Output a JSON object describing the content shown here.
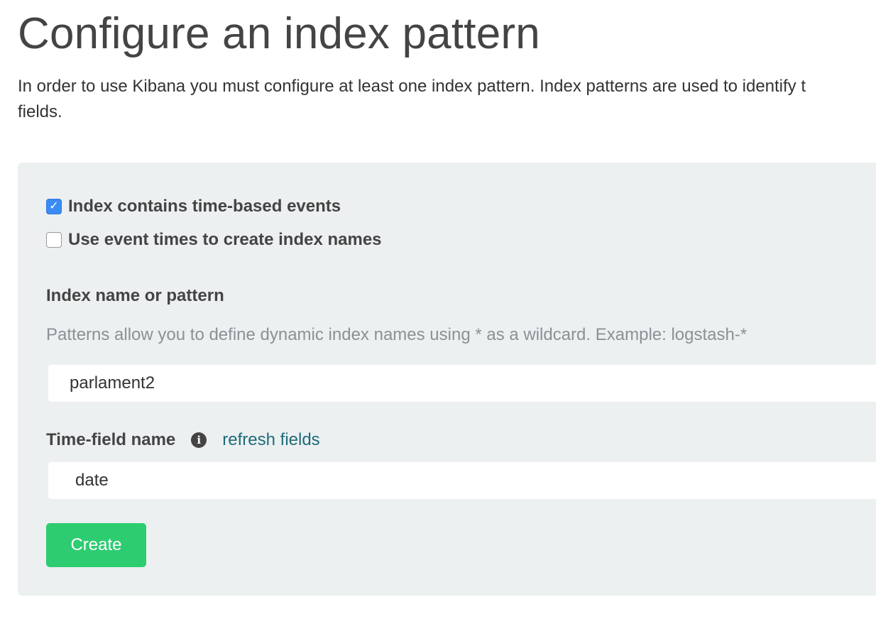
{
  "header": {
    "title": "Configure an index pattern",
    "intro_line1": "In order to use Kibana you must configure at least one index pattern. Index patterns are used to identify t",
    "intro_line2": "fields."
  },
  "form": {
    "time_based_checkbox": {
      "label": "Index contains time-based events",
      "checked": true
    },
    "event_times_checkbox": {
      "label": "Use event times to create index names",
      "checked": false
    },
    "index_name": {
      "label": "Index name or pattern",
      "help": "Patterns allow you to define dynamic index names using * as a wildcard. Example: logstash-*",
      "value": "parlament2"
    },
    "time_field": {
      "label": "Time-field name",
      "refresh_link": "refresh fields",
      "value": "date"
    },
    "create_button": "Create"
  },
  "colors": {
    "panel_background": "#ecf0f1",
    "create_button": "#2ecc71",
    "link": "#1f6b7a",
    "checkbox_checked": "#3b8bf5",
    "help_text": "#8a9296"
  },
  "icons": {
    "info": "info-circle-icon",
    "check": "checkmark-icon"
  }
}
